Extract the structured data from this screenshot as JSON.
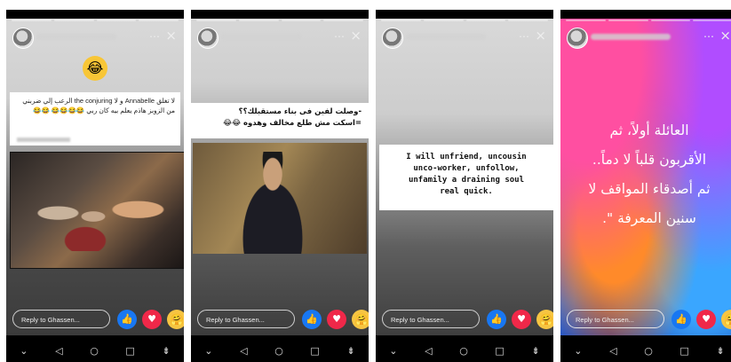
{
  "stories": [
    {
      "caption": "لا تغلق Annabelle و لا the conjuring الرعب إلي ضربني من الزوبز هاذم يعلم بيه كان ربي 😂😂😂😂 😂😂",
      "reply_placeholder": "Reply to Ghassen..."
    },
    {
      "caption_line1": "-وصلت لفين فى بناء مستقبلك؟؟",
      "caption_line2": "=اسكت مش طلع مخالف وهدوه 😂😂",
      "reply_placeholder": "Reply to Ghassen..."
    },
    {
      "text_line1": "I will unfriend, uncousin",
      "text_line2": "unco-worker, unfollow,",
      "text_line3": "unfamily a draining soul",
      "text_line4": "real quick.",
      "reply_placeholder": "Reply to Ghassen..."
    },
    {
      "quote_line1": "العائلة أولاً، ثم",
      "quote_line2": "الأقربون قلباً لا دماً..",
      "quote_line3": "ثم أصدقاء المواقف لا",
      "quote_line4": "سنين المعرفة \".",
      "reply_placeholder": "Reply to Ghassen..."
    }
  ],
  "icons": {
    "more": "⋯",
    "close": "×",
    "like": "👍",
    "love": "♥",
    "care": "🤗",
    "laugh": "😂",
    "nav_down": "⌄",
    "nav_back": "◁",
    "nav_home": "○",
    "nav_recent": "□",
    "nav_menu": "⇟"
  },
  "colors": {
    "like": "#1877f2",
    "love": "#f02849",
    "care": "#f7c542"
  }
}
